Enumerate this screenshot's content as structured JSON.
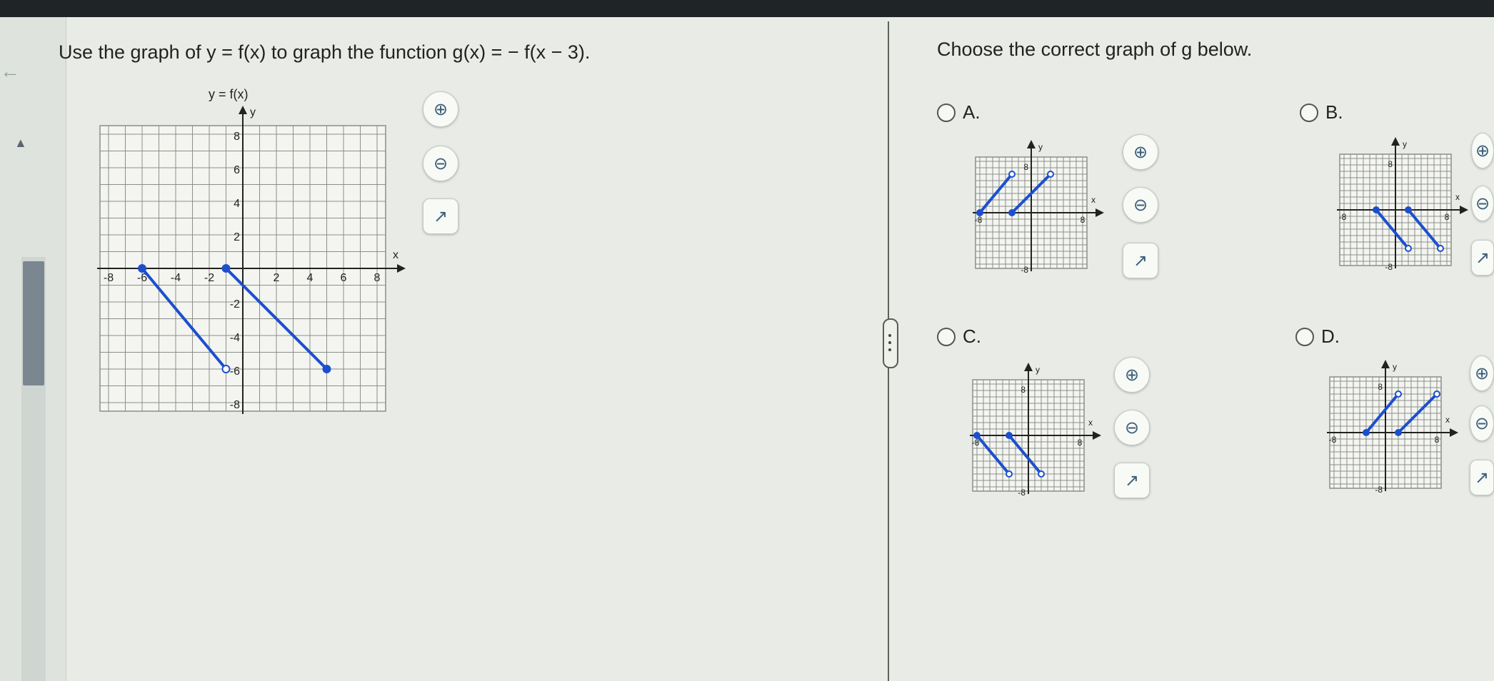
{
  "question": {
    "text": "Use the graph of y = f(x) to graph the function g(x) = − f(x − 3)."
  },
  "prompt": {
    "text": "Choose the correct graph of g below."
  },
  "main_graph": {
    "title": "y = f(x)"
  },
  "options": [
    {
      "letter": "A."
    },
    {
      "letter": "B."
    },
    {
      "letter": "C."
    },
    {
      "letter": "D."
    }
  ],
  "tools": {
    "zoom_in_icon": "⊕",
    "zoom_out_icon": "⊖",
    "popout_icon": "↗"
  },
  "colors": {
    "line": "#1c4fcf",
    "grid": "#8a8f8a",
    "axis": "#222222",
    "background": "#e9ece6"
  },
  "chart_data": [
    {
      "type": "line",
      "title": "y = f(x)",
      "xlabel": "x",
      "ylabel": "y",
      "xlim": [
        -8,
        8
      ],
      "ylim": [
        -8,
        8
      ],
      "grid": true,
      "tick_labels_x": [
        "-8",
        "-6",
        "-4",
        "-2",
        "2",
        "4",
        "6",
        "8"
      ],
      "tick_labels_y": [
        "8",
        "6",
        "4",
        "2",
        "-2",
        "-4",
        "-6",
        "-8"
      ],
      "series": [
        {
          "points": [
            [
              -6,
              0
            ],
            [
              -1,
              -6
            ]
          ],
          "start_closed": true,
          "end_open": true
        },
        {
          "points": [
            [
              -1,
              0
            ],
            [
              5,
              -6
            ]
          ],
          "start_closed": true,
          "end_open": false
        }
      ]
    },
    {
      "option": "A.",
      "type": "line",
      "xlabel": "x",
      "ylabel": "y",
      "xlim": [
        -8,
        8
      ],
      "ylim": [
        -8,
        8
      ],
      "grid": true,
      "tick_labels": {
        "top": "8",
        "bottom": "-8",
        "left": "-8",
        "right": "8"
      },
      "series": [
        {
          "points": [
            [
              -8,
              0
            ],
            [
              -3,
              6
            ]
          ],
          "start_closed": true,
          "end_open": true
        },
        {
          "points": [
            [
              -3,
              0
            ],
            [
              3,
              6
            ]
          ],
          "start_closed": true,
          "end_open": true
        }
      ]
    },
    {
      "option": "B.",
      "type": "line",
      "xlabel": "x",
      "ylabel": "y",
      "xlim": [
        -8,
        8
      ],
      "ylim": [
        -8,
        8
      ],
      "grid": true,
      "tick_labels": {
        "top": "8",
        "bottom": "-8",
        "left": "-8",
        "right": "8"
      },
      "series": [
        {
          "points": [
            [
              -3,
              0
            ],
            [
              2,
              -6
            ]
          ],
          "start_closed": true,
          "end_open": true
        },
        {
          "points": [
            [
              2,
              0
            ],
            [
              7,
              -6
            ]
          ],
          "start_closed": true,
          "end_open": true
        }
      ]
    },
    {
      "option": "C.",
      "type": "line",
      "xlabel": "x",
      "ylabel": "y",
      "xlim": [
        -8,
        8
      ],
      "ylim": [
        -8,
        8
      ],
      "grid": true,
      "tick_labels": {
        "top": "8",
        "bottom": "-8",
        "left": "-8",
        "right": "8"
      },
      "series": [
        {
          "points": [
            [
              -8,
              0
            ],
            [
              -3,
              -6
            ]
          ],
          "start_closed": true,
          "end_open": true
        },
        {
          "points": [
            [
              -3,
              0
            ],
            [
              2,
              -6
            ]
          ],
          "start_closed": true,
          "end_open": true
        }
      ]
    },
    {
      "option": "D.",
      "type": "line",
      "xlabel": "x",
      "ylabel": "y",
      "xlim": [
        -8,
        8
      ],
      "ylim": [
        -8,
        8
      ],
      "grid": true,
      "tick_labels": {
        "top": "8",
        "bottom": "-8",
        "left": "-8",
        "right": "8"
      },
      "series": [
        {
          "points": [
            [
              -3,
              0
            ],
            [
              2,
              6
            ]
          ],
          "start_closed": true,
          "end_open": true
        },
        {
          "points": [
            [
              2,
              0
            ],
            [
              8,
              6
            ]
          ],
          "start_closed": true,
          "end_open": true
        }
      ]
    }
  ]
}
